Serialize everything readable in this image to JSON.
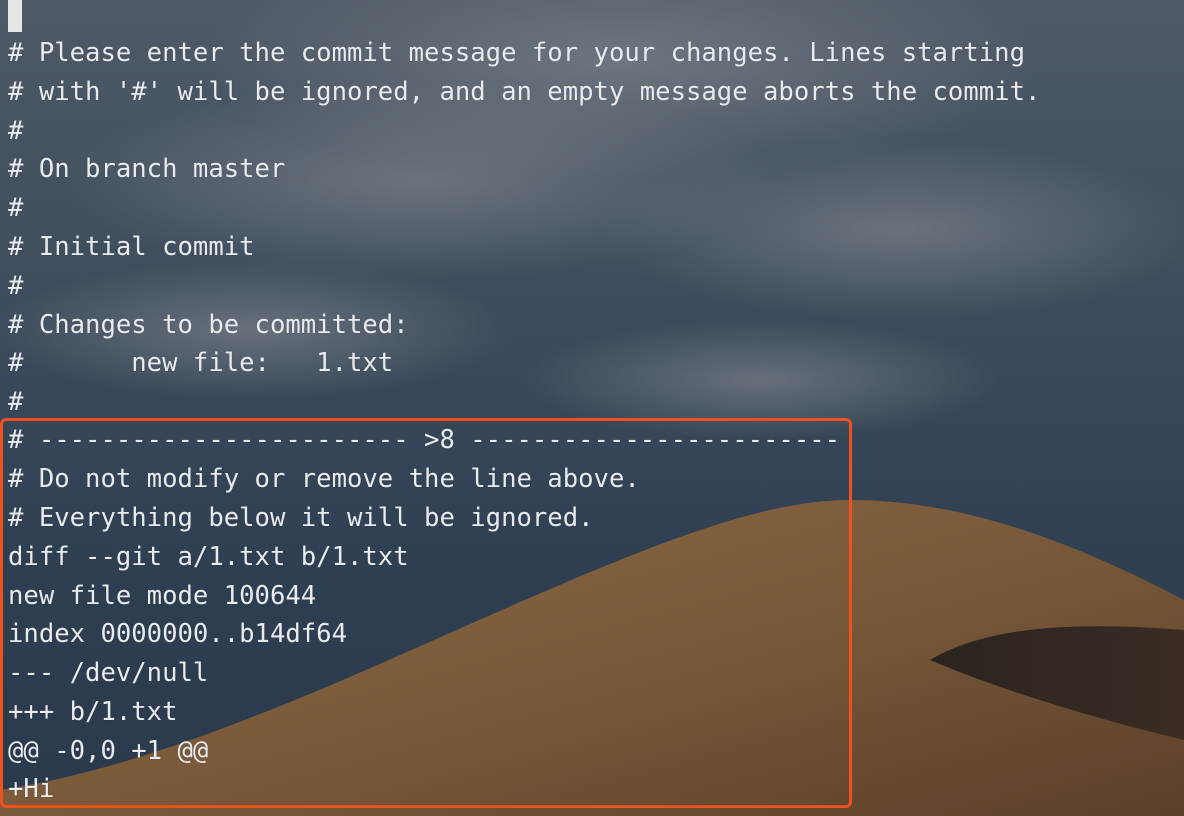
{
  "terminal": {
    "lines": [
      "# Please enter the commit message for your changes. Lines starting",
      "# with '#' will be ignored, and an empty message aborts the commit.",
      "#",
      "# On branch master",
      "#",
      "# Initial commit",
      "#",
      "# Changes to be committed:",
      "#       new file:   1.txt",
      "#",
      "# ------------------------ >8 ------------------------",
      "# Do not modify or remove the line above.",
      "# Everything below it will be ignored.",
      "diff --git a/1.txt b/1.txt",
      "new file mode 100644",
      "index 0000000..b14df64",
      "--- /dev/null",
      "+++ b/1.txt",
      "@@ -0,0 +1 @@",
      "+Hi"
    ]
  },
  "colors": {
    "text": "#e8ecef",
    "highlight_border": "#f0521f",
    "cursor": "#e6e6e6"
  }
}
